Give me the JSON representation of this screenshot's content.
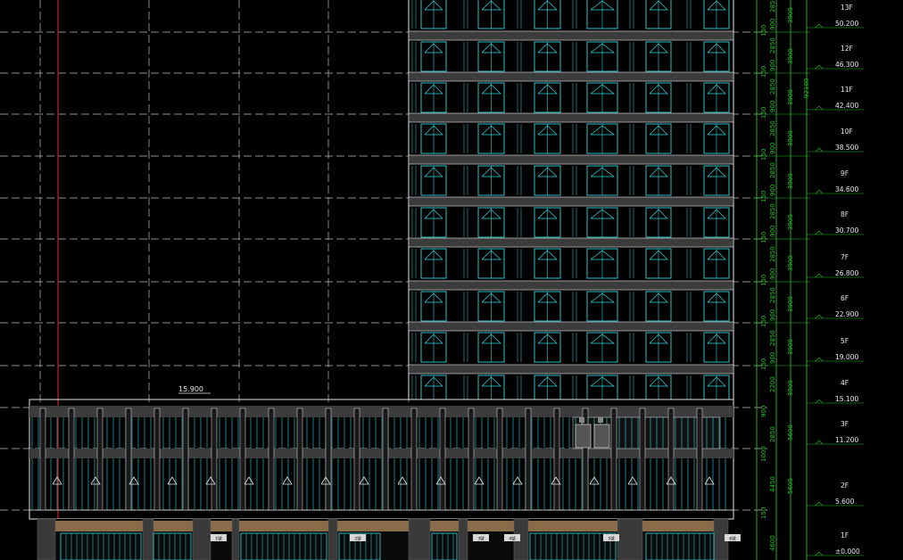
{
  "drawing": {
    "colors": {
      "background": "#000000",
      "gridline": "#bfbfbf",
      "axis_line": "#c81e1e",
      "facade": "#2fd8e0",
      "slab": "#3c3c3c",
      "outline": "#e6e6e6",
      "dimension": "#22c022",
      "podium_band": "#8a6b4a",
      "column": "#3a3a3a",
      "label": "#e8e8e8"
    },
    "podium_elevation_label": "15.900",
    "tower_floor_count_from_5F_to_13F": 9,
    "floors": [
      {
        "name": "13F",
        "elevation": "50.200"
      },
      {
        "name": "12F",
        "elevation": "46.300"
      },
      {
        "name": "11F",
        "elevation": "42.400"
      },
      {
        "name": "10F",
        "elevation": "38.500"
      },
      {
        "name": "9F",
        "elevation": "34.600"
      },
      {
        "name": "8F",
        "elevation": "30.700"
      },
      {
        "name": "7F",
        "elevation": "26.800"
      },
      {
        "name": "6F",
        "elevation": "22.900"
      },
      {
        "name": "5F",
        "elevation": "19.000"
      },
      {
        "name": "4F",
        "elevation": "15.100"
      },
      {
        "name": "3F",
        "elevation": "11.200"
      },
      {
        "name": "2F",
        "elevation": "5.600"
      },
      {
        "name": "1F",
        "elevation": "±0.000"
      }
    ],
    "dims_inner": {
      "tower_repeat": [
        "2850",
        "900",
        "150"
      ],
      "podium": [
        "2200",
        "900",
        "2850",
        "1000",
        "4450",
        "150",
        "4600"
      ]
    },
    "dims_outer": [
      "3900",
      "3900",
      "3900",
      "3900",
      "3900",
      "3900",
      "3900",
      "3900",
      "3900",
      "3900",
      "5600",
      "5600"
    ],
    "overall_dim": "92100",
    "shop_signs": [
      "1號",
      "2號",
      "3號",
      "4號",
      "5號",
      "6號"
    ]
  }
}
